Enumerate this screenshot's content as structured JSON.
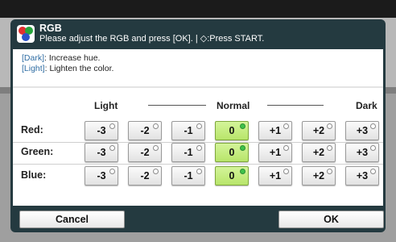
{
  "dialog": {
    "title": "RGB",
    "instruction": "Please adjust the RGB and press [OK]. | ◇:Press START.",
    "hints": [
      {
        "key": "[Dark]",
        "text": ": Increase hue."
      },
      {
        "key": "[Light]",
        "text": ": Lighten the color."
      }
    ]
  },
  "scale": {
    "light": "Light",
    "normal": "Normal",
    "dark": "Dark"
  },
  "values": [
    "-3",
    "-2",
    "-1",
    "0",
    "+1",
    "+2",
    "+3"
  ],
  "rows": [
    {
      "label": "Red:",
      "selected": "0"
    },
    {
      "label": "Green:",
      "selected": "0"
    },
    {
      "label": "Blue:",
      "selected": "0"
    }
  ],
  "buttons": {
    "cancel": "Cancel",
    "ok": "OK"
  },
  "colors": {
    "selected": "#c6ec7c",
    "dialog": "#243a40",
    "hint_key": "#2f6da3"
  }
}
